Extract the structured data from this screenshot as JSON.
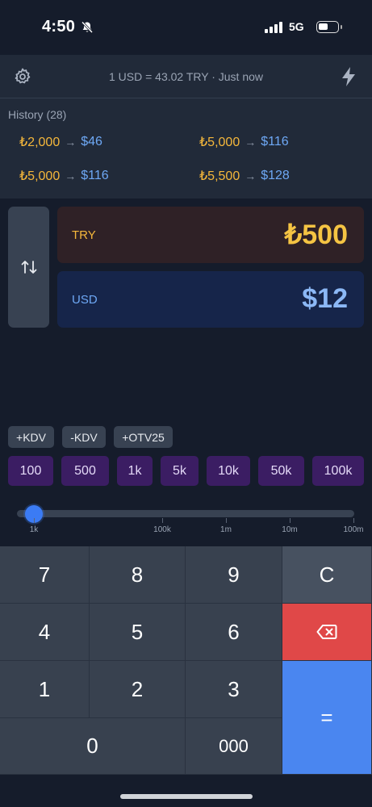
{
  "status_bar": {
    "time": "4:50",
    "network": "5G"
  },
  "header": {
    "rate_text": "1 USD = 43.02 TRY · Just now",
    "settings_icon": "gear-icon",
    "quick_icon": "bolt-icon"
  },
  "history": {
    "title": "History (28)",
    "items": [
      {
        "from": "₺2,000",
        "to": "$46"
      },
      {
        "from": "₺5,000",
        "to": "$116"
      },
      {
        "from": "₺5,000",
        "to": "$116"
      },
      {
        "from": "₺5,500",
        "to": "$128"
      }
    ],
    "arrow": "→"
  },
  "converter": {
    "swap_icon": "swap-arrows-icon",
    "source": {
      "code": "TRY",
      "amount": "₺500"
    },
    "target": {
      "code": "USD",
      "amount": "$12"
    }
  },
  "tax_chips": [
    "+KDV",
    "-KDV",
    "+OTV25"
  ],
  "presets": [
    "100",
    "500",
    "1k",
    "5k",
    "10k",
    "50k",
    "100k"
  ],
  "slider": {
    "value_fraction": 0.05,
    "labels": [
      "1k",
      "100k",
      "1m",
      "10m",
      "100m"
    ]
  },
  "keypad": {
    "rows": [
      [
        "7",
        "8",
        "9"
      ],
      [
        "4",
        "5",
        "6"
      ],
      [
        "1",
        "2",
        "3"
      ]
    ],
    "clear": "C",
    "backspace_icon": "backspace-icon",
    "equals": "=",
    "zero": "0",
    "triple_zero": "000"
  },
  "colors": {
    "accent": "#3b7bf4",
    "try": "#f5c443",
    "usd": "#8cb8f5",
    "danger": "#e04848"
  }
}
